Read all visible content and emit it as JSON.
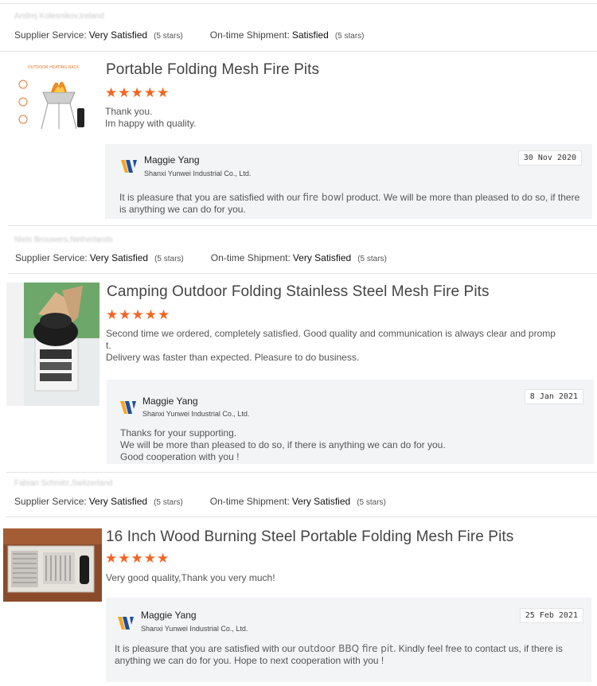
{
  "reviews": [
    {
      "reviewer": "Andrej Kolesnikov,Ireland",
      "ratings": {
        "supplier_label": "Supplier Service:",
        "supplier_value": "Very Satisfied",
        "supplier_stars": "(5 stars)",
        "shipment_label": "On-time Shipment:",
        "shipment_value": "Satisfied",
        "shipment_stars": "(5 stars)"
      },
      "product_title": "Portable Folding Mesh Fire Pits",
      "star_rating": 5,
      "thumb_caption": "OUTDOOR HEATING RACK",
      "comment": [
        "Thank you.",
        "Im happy with quality."
      ],
      "reply": {
        "name": "Maggie Yang",
        "company": "Shanxi Yunwei Industrial Co., Ltd.",
        "date": "30 Nov 2020",
        "text_before": "It is pleasure that you are satisfied with our",
        "keyword": "fire bowl",
        "text_after": "product. We will be more than pleased to do so, if there is anything we can do for you."
      }
    },
    {
      "reviewer": "Niels Brouwers,Netherlands",
      "ratings": {
        "supplier_label": "Supplier Service:",
        "supplier_value": "Very Satisfied",
        "supplier_stars": "(5 stars)",
        "shipment_label": "On-time Shipment:",
        "shipment_value": "Very Satisfied",
        "shipment_stars": "(5 stars)"
      },
      "product_title": "Camping Outdoor Folding Stainless Steel Mesh Fire Pits",
      "star_rating": 5,
      "comment": [
        "Second time we ordered, completely satisfied. Good quality and communication is always clear and promp",
        "t.",
        "Delivery was faster than expected. Pleasure to do business."
      ],
      "reply": {
        "name": "Maggie Yang",
        "company": "Shanxi Yunwei Industrial Co., Ltd.",
        "date": "8 Jan 2021",
        "lines": [
          "Thanks for your supporting.",
          "We will be more than pleased to do so, if there is anything we can do for you.",
          "Good cooperation with you !"
        ]
      }
    },
    {
      "reviewer": "Fabian Schmitz,Switzerland",
      "ratings": {
        "supplier_label": "Supplier Service:",
        "supplier_value": "Very Satisfied",
        "supplier_stars": "(5 stars)",
        "shipment_label": "On-time Shipment:",
        "shipment_value": "Very Satisfied",
        "shipment_stars": "(5 stars)"
      },
      "product_title": "16 Inch Wood Burning Steel Portable Folding Mesh Fire Pits",
      "star_rating": 5,
      "comment": [
        "Very good quality,Thank you very much!"
      ],
      "reply": {
        "name": "Maggie Yang",
        "company": "Shanxi Yunwei Industrial Co., Ltd.",
        "date": "25 Feb 2021",
        "text_before": "It is pleasure that you are satisfied with our",
        "keyword": "outdoor BBQ fire pit.",
        "text_after": "Kindly feel free to contact us, if there is anything we can do for you. Hope to next cooperation with you !"
      }
    }
  ],
  "colors": {
    "star": "#f26522",
    "logo_blue": "#1f4e9e",
    "logo_orange": "#f5a623",
    "reply_bg": "#f3f4f6"
  }
}
